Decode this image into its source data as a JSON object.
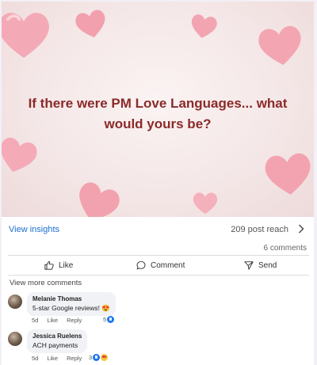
{
  "post": {
    "image_text": "If there were PM Love Languages... what would yours be?",
    "view_insights": "View insights",
    "post_reach": "209 post reach",
    "comments_count": "6 comments"
  },
  "actions": {
    "like": "Like",
    "comment": "Comment",
    "send": "Send"
  },
  "comments_section": {
    "view_more": "View more comments",
    "items": [
      {
        "author": "Melanie Thomas",
        "text": "5-star Google reviews! 😍",
        "age": "5d",
        "like_label": "Like",
        "reply_label": "Reply",
        "reaction_count": "5"
      },
      {
        "author": "Jessica Ruelens",
        "text": "ACH payments",
        "age": "5d",
        "like_label": "Like",
        "reply_label": "Reply",
        "reaction_count": "3"
      }
    ]
  },
  "colors": {
    "headline": "#8b2a2a",
    "link": "#1a6fd1",
    "heart": "#f3a7b3"
  }
}
